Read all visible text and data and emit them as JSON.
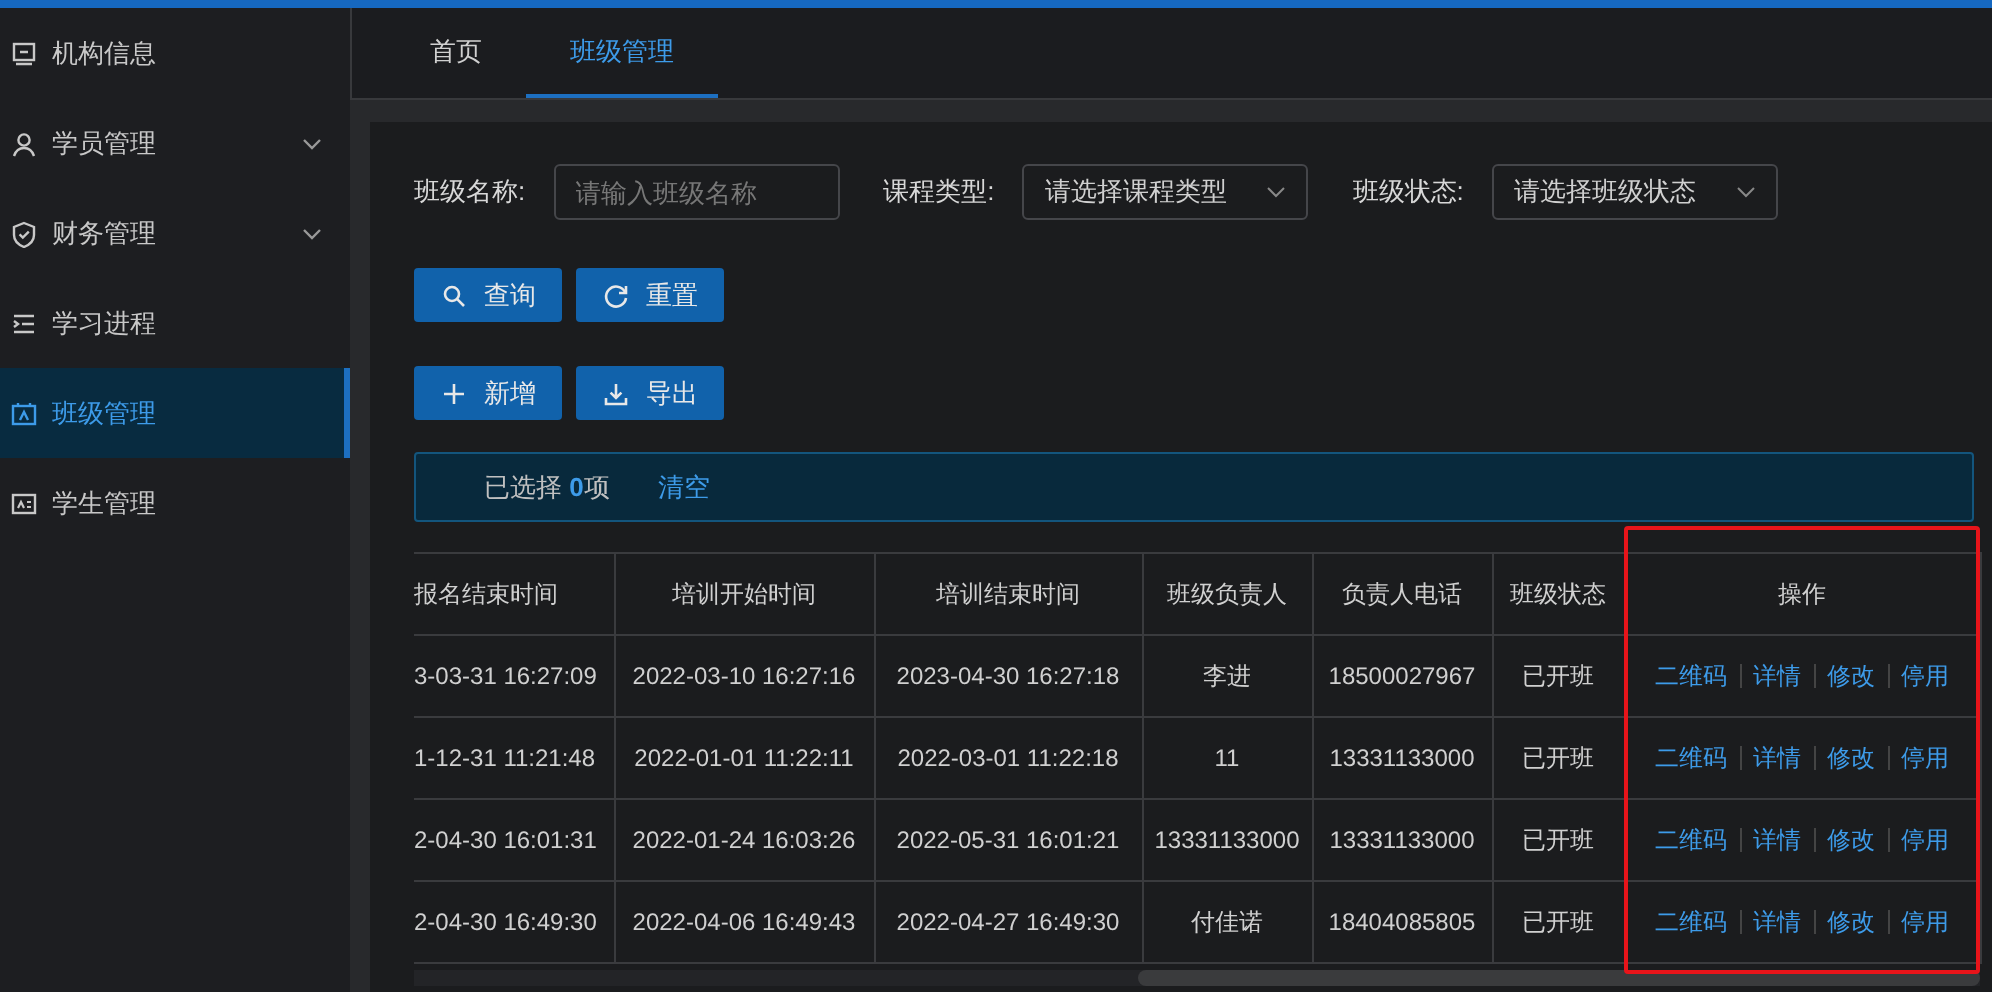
{
  "sidebar": {
    "items": [
      {
        "label": "机构信息",
        "expandable": false,
        "selected": false
      },
      {
        "label": "学员管理",
        "expandable": true,
        "selected": false
      },
      {
        "label": "财务管理",
        "expandable": true,
        "selected": false
      },
      {
        "label": "学习进程",
        "expandable": false,
        "selected": false
      },
      {
        "label": "班级管理",
        "expandable": false,
        "selected": true
      },
      {
        "label": "学生管理",
        "expandable": false,
        "selected": false
      }
    ]
  },
  "tabs": [
    {
      "label": "首页",
      "selected": false
    },
    {
      "label": "班级管理",
      "selected": true
    }
  ],
  "filters": [
    {
      "kind": "input",
      "label": "班级名称:",
      "placeholder": "请输入班级名称"
    },
    {
      "kind": "select",
      "label": "课程类型:",
      "placeholder": "请选择课程类型"
    },
    {
      "kind": "select",
      "label": "班级状态:",
      "placeholder": "请选择班级状态"
    }
  ],
  "button_rows": [
    [
      {
        "label": "查询"
      },
      {
        "label": "重置"
      }
    ],
    [
      {
        "label": "新增"
      },
      {
        "label": "导出"
      }
    ]
  ],
  "selection_bar": {
    "text": "已选择 **0**项",
    "clear": "清空"
  },
  "table": {
    "columns": [
      "报名结束时间",
      "培训开始时间",
      "培训结束时间",
      "班级负责人",
      "负责人电话",
      "班级状态",
      "操作"
    ],
    "rows": [
      {
        "cells": [
          "3-03-31 16:27:09",
          "2022-03-10 16:27:16",
          "2023-04-30 16:27:18",
          "李进",
          "18500027967",
          "已开班"
        ],
        "actions": [
          "二维码",
          "详情",
          "修改",
          "停用"
        ]
      },
      {
        "cells": [
          "1-12-31 11:21:48",
          "2022-01-01 11:22:11",
          "2022-03-01 11:22:18",
          "11",
          "13331133000",
          "已开班"
        ],
        "actions": [
          "二维码",
          "详情",
          "修改",
          "停用"
        ]
      },
      {
        "cells": [
          "2-04-30 16:01:31",
          "2022-01-24 16:03:26",
          "2022-05-31 16:01:21",
          "13331133000",
          "13331133000",
          "已开班"
        ],
        "actions": [
          "二维码",
          "详情",
          "修改",
          "停用"
        ]
      },
      {
        "cells": [
          "2-04-30 16:49:30",
          "2022-04-06 16:49:43",
          "2022-04-27 16:49:30",
          "付佳诺",
          "18404085805",
          "已开班"
        ],
        "actions": [
          "二维码",
          "详情",
          "修改",
          "停用"
        ]
      }
    ]
  }
}
